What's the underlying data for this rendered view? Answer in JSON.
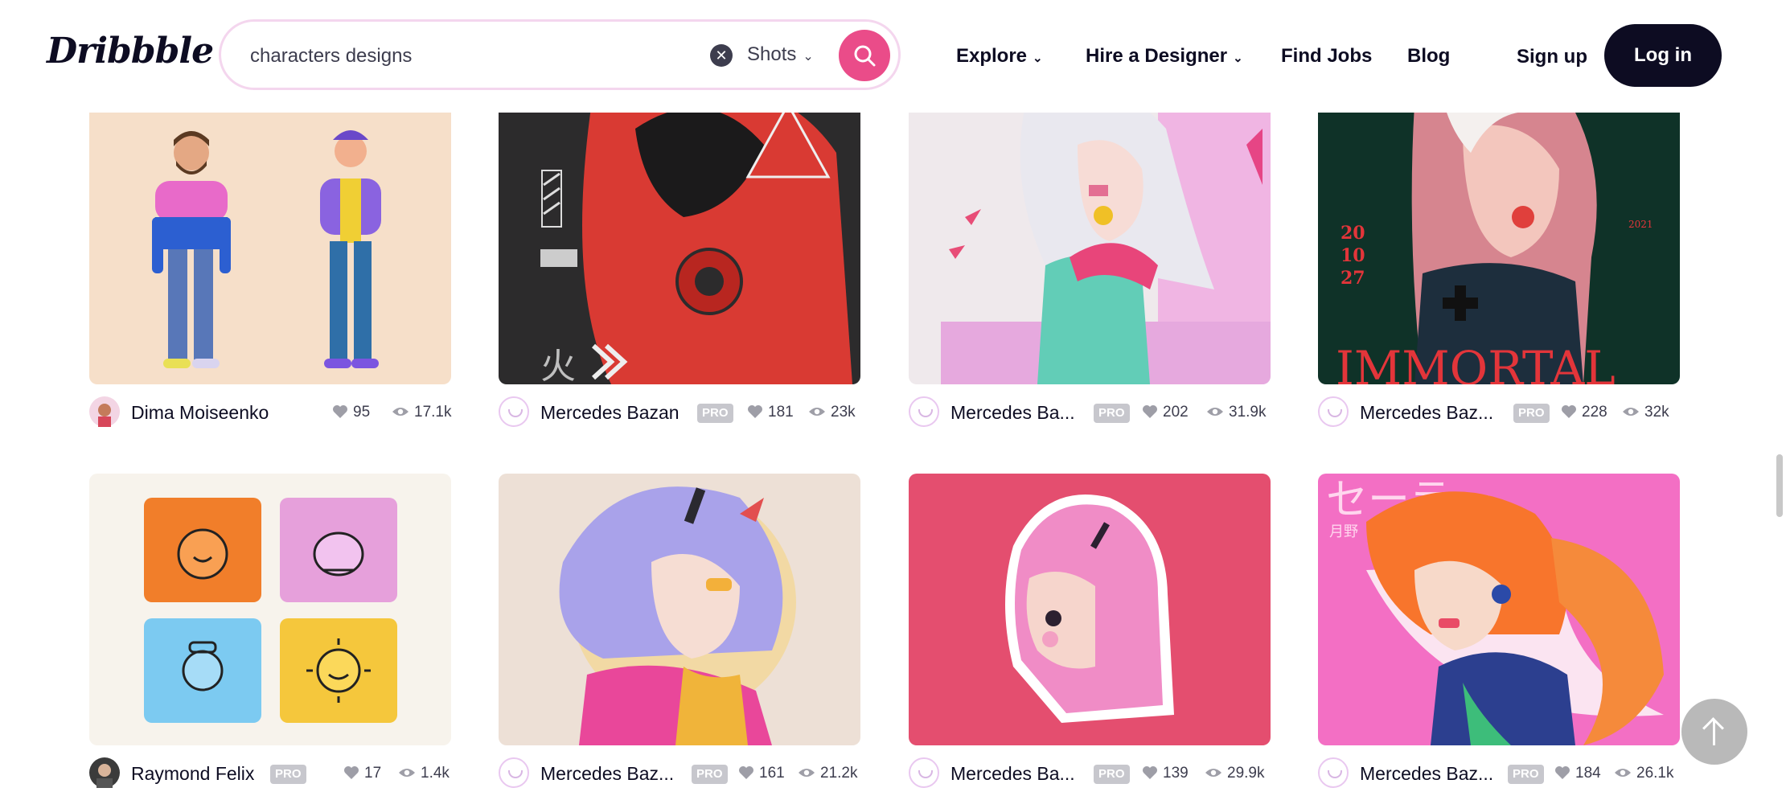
{
  "header": {
    "logo": "Dribbble",
    "search_value": "characters designs",
    "scope": "Shots",
    "nav": [
      {
        "label": "Explore"
      },
      {
        "label": "Hire a Designer"
      },
      {
        "label": "Find Jobs"
      },
      {
        "label": "Blog"
      }
    ],
    "signup": "Sign up",
    "login": "Log in"
  },
  "pro_label": "PRO",
  "shots": [
    {
      "author": "Dima Moiseenko",
      "pro": false,
      "likes": "95",
      "views": "17.1k"
    },
    {
      "author": "Mercedes Bazan",
      "pro": true,
      "likes": "181",
      "views": "23k"
    },
    {
      "author": "Mercedes Ba...",
      "pro": true,
      "likes": "202",
      "views": "31.9k"
    },
    {
      "author": "Mercedes Baz...",
      "pro": true,
      "likes": "228",
      "views": "32k"
    },
    {
      "author": "Raymond Felix",
      "pro": true,
      "likes": "17",
      "views": "1.4k"
    },
    {
      "author": "Mercedes Baz...",
      "pro": true,
      "likes": "161",
      "views": "21.2k"
    },
    {
      "author": "Mercedes Ba...",
      "pro": true,
      "likes": "139",
      "views": "29.9k"
    },
    {
      "author": "Mercedes Baz...",
      "pro": true,
      "likes": "184",
      "views": "26.1k"
    }
  ],
  "artwork_text": {
    "immortal_title": "IMMORTAL",
    "immortal_dates": [
      "20",
      "10",
      "27"
    ],
    "immortal_year": "2021",
    "sailor_kana": "セーラー",
    "sailor_name": "月野",
    "kanji_fire": "火"
  },
  "colors": {
    "brand_pink": "#ea4c89",
    "text_dark": "#0d0c22",
    "pro_badge": "#c7c7cd"
  }
}
